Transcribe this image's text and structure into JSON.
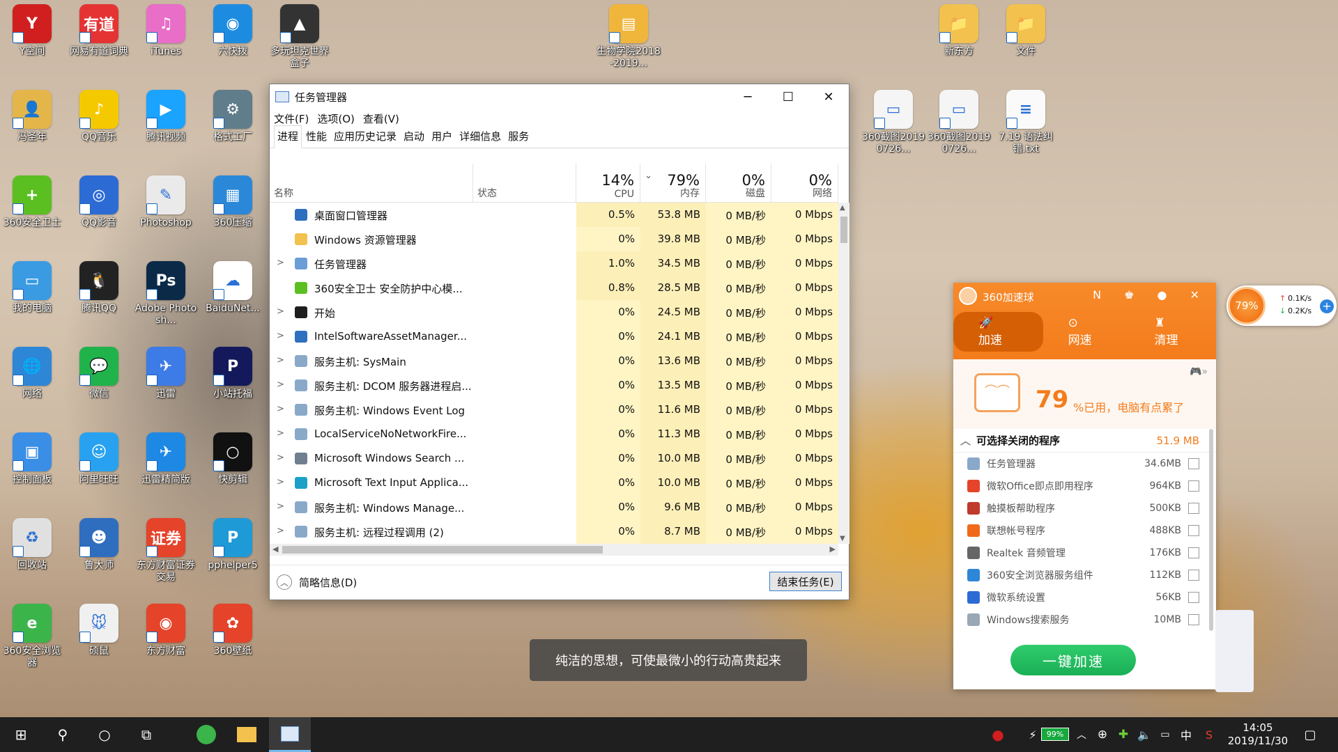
{
  "desktop_icons": [
    {
      "label": "Y空间",
      "color": "#d11f1f",
      "glyph": "Y"
    },
    {
      "label": "网易有道词典",
      "color": "#e53333",
      "glyph": "有道"
    },
    {
      "label": "iTunes",
      "color": "#e86ec8",
      "glyph": "♫"
    },
    {
      "label": "六快拨",
      "color": "#1d8ce0",
      "glyph": "◉"
    },
    {
      "label": "多玩坦克世界盒子",
      "color": "#333333",
      "glyph": "▲"
    },
    {
      "label": "冯圣年",
      "color": "#e4b64a",
      "glyph": "👤"
    },
    {
      "label": "QQ音乐",
      "color": "#f5c900",
      "glyph": "♪"
    },
    {
      "label": "腾讯视频",
      "color": "#1aa3ff",
      "glyph": "▶"
    },
    {
      "label": "格式工厂",
      "color": "#607d8b",
      "glyph": "⚙"
    },
    {
      "label": "360安全卫士",
      "color": "#5bbf21",
      "glyph": "+"
    },
    {
      "label": "QQ影音",
      "color": "#2d6bd4",
      "glyph": "◎"
    },
    {
      "label": "Photoshop",
      "color": "#eaeaea",
      "glyph": "✎"
    },
    {
      "label": "360压缩",
      "color": "#2b88d8",
      "glyph": "▦"
    },
    {
      "label": "我的电脑",
      "color": "#3a9be3",
      "glyph": "▭"
    },
    {
      "label": "腾讯QQ",
      "color": "#222222",
      "glyph": "🐧"
    },
    {
      "label": "Adobe Photosh...",
      "color": "#0b2a48",
      "glyph": "Ps"
    },
    {
      "label": "BaiduNet...",
      "color": "#ffffff",
      "glyph": "☁"
    },
    {
      "label": "网络",
      "color": "#2d86d6",
      "glyph": "🌐"
    },
    {
      "label": "微信",
      "color": "#21b34b",
      "glyph": "💬"
    },
    {
      "label": "迅雷",
      "color": "#3d7be6",
      "glyph": "✈"
    },
    {
      "label": "小站托福",
      "color": "#13195a",
      "glyph": "P"
    },
    {
      "label": "控制面板",
      "color": "#3a8ee6",
      "glyph": "▣"
    },
    {
      "label": "阿里旺旺",
      "color": "#28a2f0",
      "glyph": "☺"
    },
    {
      "label": "迅雷精简版",
      "color": "#1e88e5",
      "glyph": "✈"
    },
    {
      "label": "快剪辑",
      "color": "#111111",
      "glyph": "○"
    },
    {
      "label": "回收站",
      "color": "#e0e0e0",
      "glyph": "♻"
    },
    {
      "label": "鲁大师",
      "color": "#2f6dbf",
      "glyph": "☻"
    },
    {
      "label": "东方财富证券交易",
      "color": "#e5432a",
      "glyph": "证券"
    },
    {
      "label": "pphelper5",
      "color": "#1e9ad6",
      "glyph": "P"
    },
    {
      "label": "360安全浏览器",
      "color": "#3bb44a",
      "glyph": "e"
    },
    {
      "label": "硕鼠",
      "color": "#f0f0f0",
      "glyph": "🐭"
    },
    {
      "label": "东方财富",
      "color": "#e5432a",
      "glyph": "◉"
    },
    {
      "label": "360壁纸",
      "color": "#e5432a",
      "glyph": "✿"
    },
    {
      "label": "生物学院2018-2019...",
      "color": "#f0b63c",
      "glyph": "▤"
    },
    {
      "label": "新东方",
      "color": "#f2c14e",
      "glyph": "📁"
    },
    {
      "label": "文件",
      "color": "#f2c14e",
      "glyph": "📁"
    },
    {
      "label": "360截图20190726...",
      "color": "#f5f5f5",
      "glyph": "▭"
    },
    {
      "label": "360截图20190726...",
      "color": "#f5f5f5",
      "glyph": "▭"
    },
    {
      "label": "7.19 语法纠错.txt",
      "color": "#fafafa",
      "glyph": "≡"
    }
  ],
  "task_manager": {
    "title": "任务管理器",
    "window_buttons": {
      "minimize": "─",
      "maximize": "☐",
      "close": "✕"
    },
    "menu": [
      "文件(F)",
      "选项(O)",
      "查看(V)"
    ],
    "tabs": [
      "进程",
      "性能",
      "应用历史记录",
      "启动",
      "用户",
      "详细信息",
      "服务"
    ],
    "active_tab": "进程",
    "columns": {
      "name": "名称",
      "status": "状态",
      "cpu": {
        "pct": "14%",
        "label": "CPU"
      },
      "mem": {
        "pct": "79%",
        "label": "内存"
      },
      "disk": {
        "pct": "0%",
        "label": "磁盘"
      },
      "net": {
        "pct": "0%",
        "label": "网络"
      }
    },
    "processes": [
      {
        "name": "桌面窗口管理器",
        "expand": false,
        "cpu": "0.5%",
        "mem": "53.8 MB",
        "disk": "0 MB/秒",
        "net": "0 Mbps",
        "icon": "#2f6fbf"
      },
      {
        "name": "Windows 资源管理器",
        "expand": false,
        "cpu": "0%",
        "mem": "39.8 MB",
        "disk": "0 MB/秒",
        "net": "0 Mbps",
        "icon": "#f2c14e"
      },
      {
        "name": "任务管理器",
        "expand": true,
        "cpu": "1.0%",
        "mem": "34.5 MB",
        "disk": "0 MB/秒",
        "net": "0 Mbps",
        "icon": "#6b9ed6"
      },
      {
        "name": "360安全卫士 安全防护中心模...",
        "expand": false,
        "cpu": "0.8%",
        "mem": "28.5 MB",
        "disk": "0 MB/秒",
        "net": "0 Mbps",
        "icon": "#5bbf21"
      },
      {
        "name": "开始",
        "expand": true,
        "cpu": "0%",
        "mem": "24.5 MB",
        "disk": "0 MB/秒",
        "net": "0 Mbps",
        "icon": "#1e1e1e"
      },
      {
        "name": "IntelSoftwareAssetManager...",
        "expand": true,
        "cpu": "0%",
        "mem": "24.1 MB",
        "disk": "0 MB/秒",
        "net": "0 Mbps",
        "icon": "#2f6fbf"
      },
      {
        "name": "服务主机: SysMain",
        "expand": true,
        "cpu": "0%",
        "mem": "13.6 MB",
        "disk": "0 MB/秒",
        "net": "0 Mbps",
        "icon": "#8aa9c9"
      },
      {
        "name": "服务主机: DCOM 服务器进程启...",
        "expand": true,
        "cpu": "0%",
        "mem": "13.5 MB",
        "disk": "0 MB/秒",
        "net": "0 Mbps",
        "icon": "#8aa9c9"
      },
      {
        "name": "服务主机: Windows Event Log",
        "expand": true,
        "cpu": "0%",
        "mem": "11.6 MB",
        "disk": "0 MB/秒",
        "net": "0 Mbps",
        "icon": "#8aa9c9"
      },
      {
        "name": "LocalServiceNoNetworkFire...",
        "expand": true,
        "cpu": "0%",
        "mem": "11.3 MB",
        "disk": "0 MB/秒",
        "net": "0 Mbps",
        "icon": "#8aa9c9"
      },
      {
        "name": "Microsoft Windows Search ...",
        "expand": true,
        "cpu": "0%",
        "mem": "10.0 MB",
        "disk": "0 MB/秒",
        "net": "0 Mbps",
        "icon": "#6f7f8f"
      },
      {
        "name": "Microsoft Text Input Applica...",
        "expand": true,
        "cpu": "0%",
        "mem": "10.0 MB",
        "disk": "0 MB/秒",
        "net": "0 Mbps",
        "icon": "#1ba1c6"
      },
      {
        "name": "服务主机: Windows Manage...",
        "expand": true,
        "cpu": "0%",
        "mem": "9.6 MB",
        "disk": "0 MB/秒",
        "net": "0 Mbps",
        "icon": "#8aa9c9"
      },
      {
        "name": "服务主机: 远程过程调用 (2)",
        "expand": true,
        "cpu": "0%",
        "mem": "8.7 MB",
        "disk": "0 MB/秒",
        "net": "0 Mbps",
        "icon": "#8aa9c9"
      }
    ],
    "fewer_details": "简略信息(D)",
    "end_task": "结束任务(E)"
  },
  "accelerator": {
    "title": "360加速球",
    "header_icons": "N ♚ ● ✕",
    "tabs": [
      "加速",
      "网速",
      "清理"
    ],
    "tab_icons": [
      "🚀",
      "⊙",
      "♜"
    ],
    "active_tab": "加速",
    "usage_number": "79",
    "usage_text": "%已用，电脑有点累了",
    "game_icon": "🎮»",
    "list_title": "可选择关闭的程序",
    "list_total": "51.9 MB",
    "items": [
      {
        "name": "任务管理器",
        "size": "34.6MB",
        "color": "#8aa9c9"
      },
      {
        "name": "微软Office即点即用程序",
        "size": "964KB",
        "color": "#e5432a"
      },
      {
        "name": "触摸板帮助程序",
        "size": "500KB",
        "color": "#c0392b"
      },
      {
        "name": "联想帐号程序",
        "size": "488KB",
        "color": "#f06a1a"
      },
      {
        "name": "Realtek 音频管理",
        "size": "176KB",
        "color": "#666666"
      },
      {
        "name": "360安全浏览器服务组件",
        "size": "112KB",
        "color": "#2d86d6"
      },
      {
        "name": "微软系统设置",
        "size": "56KB",
        "color": "#2d6bd4"
      },
      {
        "name": "Windows搜索服务",
        "size": "10MB",
        "color": "#9aa7b4"
      }
    ],
    "button": "一键加速"
  },
  "float_ball": {
    "percent": "79%",
    "up": "0.1K/s",
    "down": "0.2K/s",
    "plus": "+"
  },
  "toast": "纯洁的思想，可使最微小的行动高贵起来",
  "taskbar": {
    "time": "14:05",
    "date": "2019/11/30",
    "battery": "99%",
    "ime": "中",
    "start_icon": "⊞",
    "search_icon": "⚲",
    "cortana_icon": "○",
    "taskview_icon": "⧉"
  }
}
